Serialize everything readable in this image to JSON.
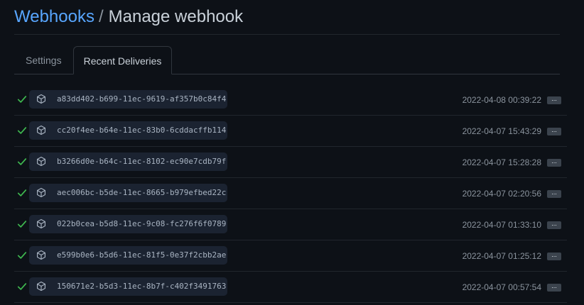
{
  "header": {
    "breadcrumb_link": "Webhooks",
    "breadcrumb_separator": "/",
    "title": "Manage webhook"
  },
  "tabs": [
    {
      "label": "Settings"
    },
    {
      "label": "Recent Deliveries"
    }
  ],
  "deliveries": [
    {
      "status": "success",
      "guid": "a83dd402-b699-11ec-9619-af357b0c84f4",
      "timestamp": "2022-04-08 00:39:22",
      "more_label": "..."
    },
    {
      "status": "success",
      "guid": "cc20f4ee-b64e-11ec-83b0-6cddacffb114",
      "timestamp": "2022-04-07 15:43:29",
      "more_label": "..."
    },
    {
      "status": "success",
      "guid": "b3266d0e-b64c-11ec-8102-ec90e7cdb79f",
      "timestamp": "2022-04-07 15:28:28",
      "more_label": "..."
    },
    {
      "status": "success",
      "guid": "aec006bc-b5de-11ec-8665-b979efbed22c",
      "timestamp": "2022-04-07 02:20:56",
      "more_label": "..."
    },
    {
      "status": "success",
      "guid": "022b0cea-b5d8-11ec-9c08-fc276f6f0789",
      "timestamp": "2022-04-07 01:33:10",
      "more_label": "..."
    },
    {
      "status": "success",
      "guid": "e599b0e6-b5d6-11ec-81f5-0e37f2cbb2ae",
      "timestamp": "2022-04-07 01:25:12",
      "more_label": "..."
    },
    {
      "status": "success",
      "guid": "150671e2-b5d3-11ec-8b7f-c402f3491763",
      "timestamp": "2022-04-07 00:57:54",
      "more_label": "..."
    }
  ],
  "colors": {
    "background": "#0d1117",
    "link": "#58a6ff",
    "success": "#3fb950",
    "pill": "#1b2331"
  },
  "icons": {
    "status": "check-icon",
    "delivery": "package-icon",
    "more": "kebab-ellipsis"
  }
}
